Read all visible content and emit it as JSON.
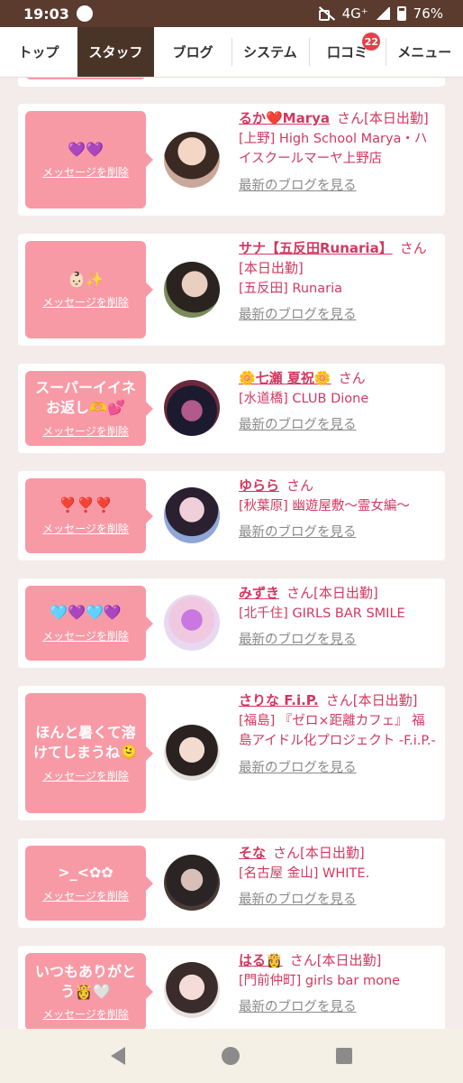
{
  "status": {
    "time": "19:03",
    "network": "4G⁺",
    "battery": "76%"
  },
  "tabs": [
    {
      "label": "トップ"
    },
    {
      "label": "スタッフ"
    },
    {
      "label": "ブログ"
    },
    {
      "label": "システム"
    },
    {
      "label": "口コミ",
      "badge": "22"
    },
    {
      "label": "メニュー"
    }
  ],
  "delete_label": "メッセージを削除",
  "blog_label": "最新のブログを見る",
  "honorific": "さん",
  "cards": [
    {
      "message": "💜💜",
      "name": "るか❤️Marya",
      "status": "[本日出勤]",
      "shop": "[上野] High School Marya・ハイスクールマーヤ上野店"
    },
    {
      "message": "👶🏻✨",
      "name": "サナ【五反田Runaria】",
      "status": "[本日出勤]",
      "shop": "[五反田] Runaria"
    },
    {
      "message": "スーパーイイネお返し🫶💕",
      "name": "🌼七瀬 夏祝🌼",
      "status": "",
      "shop": "[水道橋] CLUB Dione"
    },
    {
      "message": "❣️❣️❣️",
      "name": "ゆらら",
      "status": "",
      "shop": "[秋葉原] 幽遊屋敷〜霊女編〜"
    },
    {
      "message": "🩵💜🩵💜",
      "name": "みずき",
      "status": "[本日出勤]",
      "shop": "[北千住] GIRLS BAR SMILE"
    },
    {
      "message": "ほんと暑くて溶けてしまうね🫠",
      "name": "さりな F.i.P.",
      "status": "[本日出勤]",
      "shop": "[福島] 『ゼロ×距離カフェ』 福島アイドル化プロジェクト -F.i.P.-"
    },
    {
      "message": ">_<✿✿",
      "name": "そな",
      "status": "[本日出勤]",
      "shop": "[名古屋 金山] WHITE."
    },
    {
      "message": "いつもありがとう👸🤍",
      "name": "はる👸",
      "status": "[本日出勤]",
      "shop": "[門前仲町] girls bar mone"
    }
  ],
  "colors": {
    "accent": "#d23861",
    "bubble": "#f89aa6",
    "header_active": "#4a3428",
    "statusbar": "#5a3b2e"
  }
}
